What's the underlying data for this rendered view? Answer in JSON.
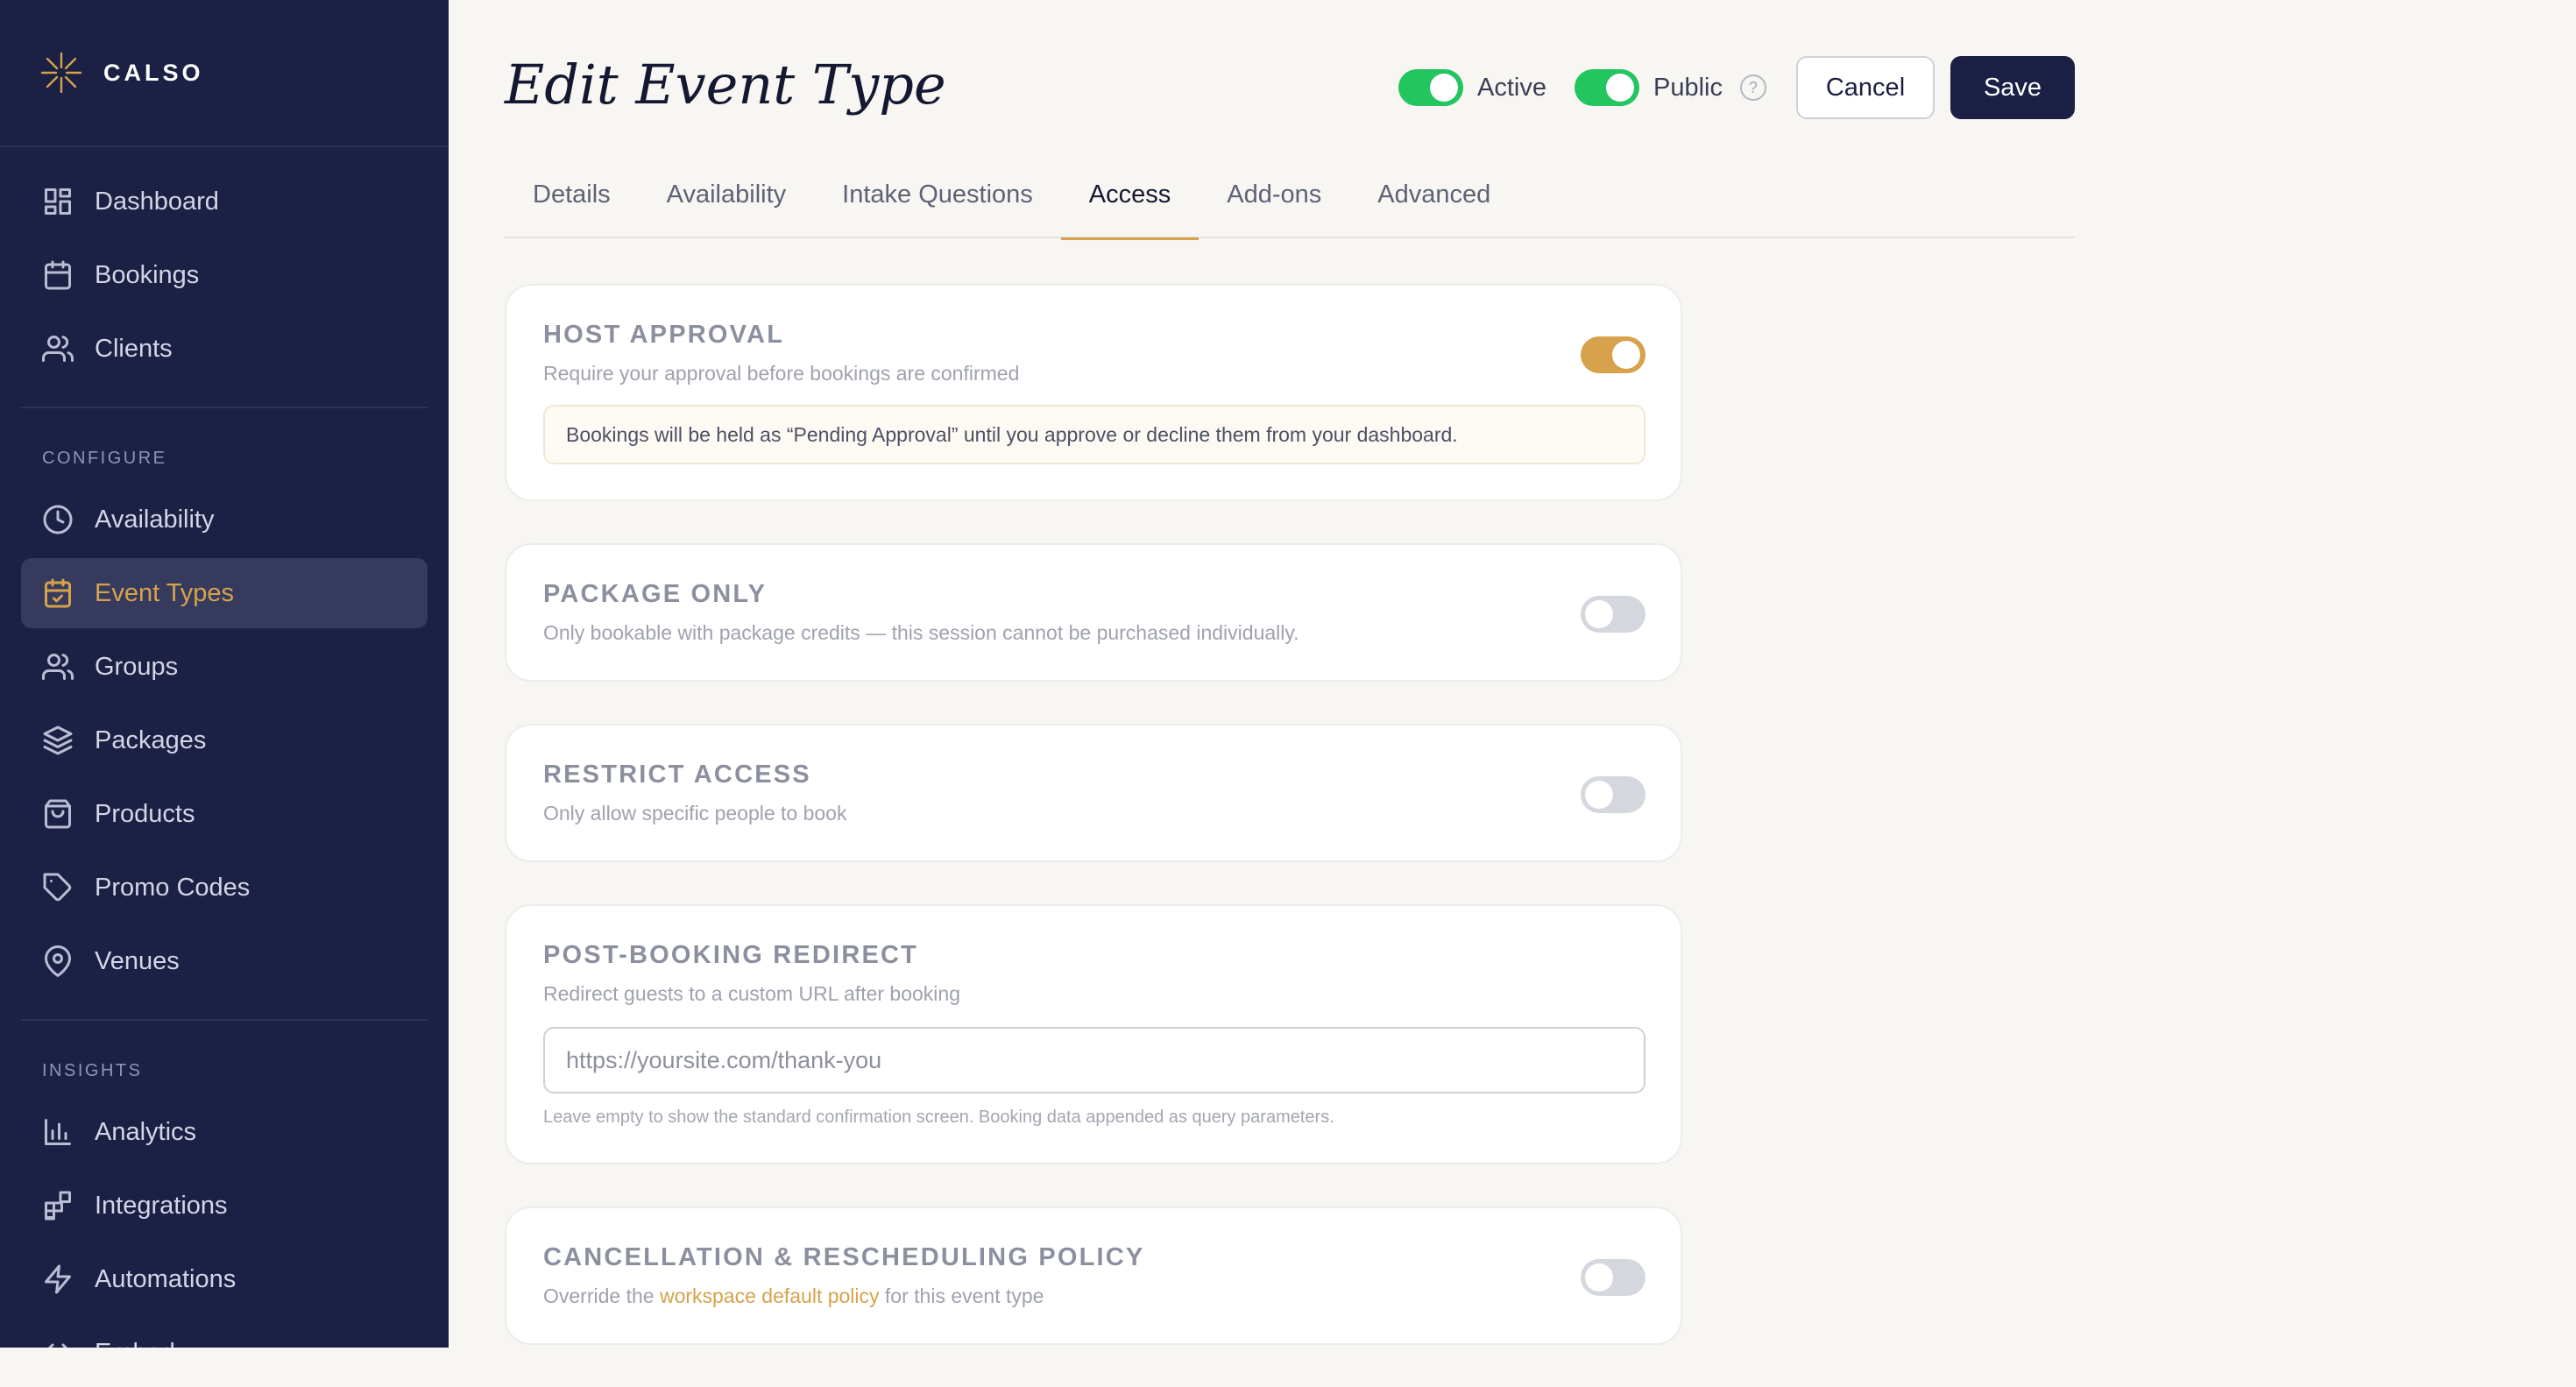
{
  "brand": {
    "name": "CALSO"
  },
  "sidebar": {
    "main_items": [
      {
        "label": "Dashboard",
        "icon": "grid-icon"
      },
      {
        "label": "Bookings",
        "icon": "calendar-icon"
      },
      {
        "label": "Clients",
        "icon": "users-icon"
      }
    ],
    "configure_heading": "CONFIGURE",
    "configure_items": [
      {
        "label": "Availability",
        "icon": "clock-icon"
      },
      {
        "label": "Event Types",
        "icon": "calendar-check-icon",
        "active": true
      },
      {
        "label": "Groups",
        "icon": "users-icon"
      },
      {
        "label": "Packages",
        "icon": "layers-icon"
      },
      {
        "label": "Products",
        "icon": "shopping-bag-icon"
      },
      {
        "label": "Promo Codes",
        "icon": "tag-icon"
      },
      {
        "label": "Venues",
        "icon": "map-pin-icon"
      }
    ],
    "insights_heading": "INSIGHTS",
    "insights_items": [
      {
        "label": "Analytics",
        "icon": "bar-chart-icon"
      },
      {
        "label": "Integrations",
        "icon": "puzzle-icon"
      },
      {
        "label": "Automations",
        "icon": "zap-icon"
      },
      {
        "label": "Embed",
        "icon": "code-icon"
      }
    ]
  },
  "header": {
    "title": "Edit Event Type",
    "active_label": "Active",
    "active_on": true,
    "public_label": "Public",
    "public_on": true,
    "help": "?",
    "cancel_label": "Cancel",
    "save_label": "Save"
  },
  "tabs": [
    {
      "label": "Details"
    },
    {
      "label": "Availability"
    },
    {
      "label": "Intake Questions"
    },
    {
      "label": "Access",
      "active": true
    },
    {
      "label": "Add-ons"
    },
    {
      "label": "Advanced"
    }
  ],
  "cards": {
    "host_approval": {
      "title": "HOST APPROVAL",
      "desc": "Require your approval before bookings are confirmed",
      "note": "Bookings will be held as “Pending Approval” until you approve or decline them from your dashboard.",
      "enabled": true
    },
    "package_only": {
      "title": "PACKAGE ONLY",
      "desc": "Only bookable with package credits — this session cannot be purchased individually.",
      "enabled": false
    },
    "restrict_access": {
      "title": "RESTRICT ACCESS",
      "desc": "Only allow specific people to book",
      "enabled": false
    },
    "redirect": {
      "title": "POST-BOOKING REDIRECT",
      "desc": "Redirect guests to a custom URL after booking",
      "placeholder": "https://yoursite.com/thank-you",
      "value": "",
      "hint": "Leave empty to show the standard confirmation screen. Booking data appended as query parameters."
    },
    "cancellation": {
      "title": "CANCELLATION & RESCHEDULING POLICY",
      "desc_prefix": "Override the",
      "desc_link": "workspace default policy",
      "desc_suffix": "for this event type",
      "enabled": false
    }
  },
  "colors": {
    "sidebar_bg": "#1b2044",
    "accent": "#d6a24c",
    "toggle_on": "#22c55e",
    "page_bg": "#f7f6f3"
  }
}
